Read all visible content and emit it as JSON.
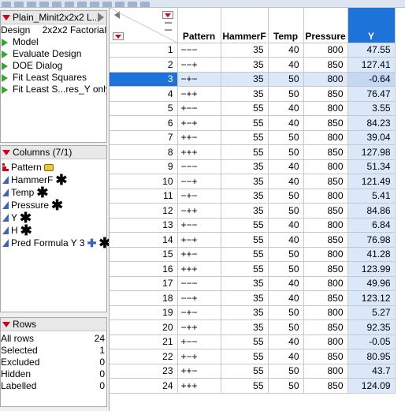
{
  "window": {
    "title": "Plain_Minit2x2x2 L..."
  },
  "left_panel": {
    "table_panel": {
      "design_label": "Design",
      "design_value": "2x2x2 Factorial",
      "scripts": [
        "Model",
        "Evaluate Design",
        "DOE Dialog",
        "Fit Least Squares",
        "Fit Least S...res_Y only"
      ]
    },
    "columns_panel": {
      "title": "Columns (7/1)",
      "items": [
        {
          "name": "Pattern",
          "type": "nominal",
          "marker": "tag-icon"
        },
        {
          "name": "HammerF",
          "type": "continuous",
          "marker": "asterisk"
        },
        {
          "name": "Temp",
          "type": "continuous",
          "marker": "asterisk"
        },
        {
          "name": "Pressure",
          "type": "continuous",
          "marker": "asterisk"
        },
        {
          "name": "Y",
          "type": "continuous",
          "marker": "asterisk",
          "selected": true
        },
        {
          "name": "H",
          "type": "continuous",
          "marker": "asterisk"
        },
        {
          "name": "Pred Formula Y 3",
          "type": "continuous",
          "marker": "plus-asterisk"
        }
      ]
    },
    "rows_panel": {
      "title": "Rows",
      "stats": [
        {
          "label": "All rows",
          "value": "24"
        },
        {
          "label": "Selected",
          "value": "1"
        },
        {
          "label": "Excluded",
          "value": "0"
        },
        {
          "label": "Hidden",
          "value": "0"
        },
        {
          "label": "Labelled",
          "value": "0"
        }
      ]
    }
  },
  "table": {
    "columns": [
      "Pattern",
      "HammerF",
      "Temp",
      "Pressure",
      "Y"
    ],
    "selected_row": 3,
    "selected_column": "Y",
    "rows": [
      [
        "1",
        "−−−",
        "35",
        "40",
        "800",
        "47.55"
      ],
      [
        "2",
        "−−+",
        "35",
        "40",
        "850",
        "127.41"
      ],
      [
        "3",
        "−+−",
        "35",
        "50",
        "800",
        "-0.64"
      ],
      [
        "4",
        "−++",
        "35",
        "50",
        "850",
        "76.47"
      ],
      [
        "5",
        "+−−",
        "55",
        "40",
        "800",
        "3.55"
      ],
      [
        "6",
        "+−+",
        "55",
        "40",
        "850",
        "84.23"
      ],
      [
        "7",
        "++−",
        "55",
        "50",
        "800",
        "39.04"
      ],
      [
        "8",
        "+++",
        "55",
        "50",
        "850",
        "127.98"
      ],
      [
        "9",
        "−−−",
        "35",
        "40",
        "800",
        "51.34"
      ],
      [
        "10",
        "−−+",
        "35",
        "40",
        "850",
        "121.49"
      ],
      [
        "11",
        "−+−",
        "35",
        "50",
        "800",
        "5.41"
      ],
      [
        "12",
        "−++",
        "35",
        "50",
        "850",
        "84.86"
      ],
      [
        "13",
        "+−−",
        "55",
        "40",
        "800",
        "6.84"
      ],
      [
        "14",
        "+−+",
        "55",
        "40",
        "850",
        "76.98"
      ],
      [
        "15",
        "++−",
        "55",
        "50",
        "800",
        "41.28"
      ],
      [
        "16",
        "+++",
        "55",
        "50",
        "850",
        "123.99"
      ],
      [
        "17",
        "−−−",
        "35",
        "40",
        "800",
        "49.96"
      ],
      [
        "18",
        "−−+",
        "35",
        "40",
        "850",
        "123.12"
      ],
      [
        "19",
        "−+−",
        "35",
        "50",
        "800",
        "5.27"
      ],
      [
        "20",
        "−++",
        "35",
        "50",
        "850",
        "92.35"
      ],
      [
        "21",
        "+−−",
        "55",
        "40",
        "800",
        "-0.05"
      ],
      [
        "22",
        "+−+",
        "55",
        "40",
        "850",
        "80.95"
      ],
      [
        "23",
        "++−",
        "55",
        "50",
        "800",
        "43.7"
      ],
      [
        "24",
        "+++",
        "55",
        "50",
        "850",
        "124.09"
      ]
    ]
  },
  "colors": {
    "selection": "#1e73d9",
    "selection_light": "#dbe8fa",
    "red_marker": "#d0021b",
    "green_script": "#3aa133"
  }
}
